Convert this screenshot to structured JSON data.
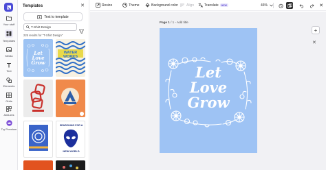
{
  "rail": {
    "items": [
      {
        "label": "Your stuff",
        "icon": "folder-icon"
      },
      {
        "label": "Templates",
        "icon": "templates-icon"
      },
      {
        "label": "Media",
        "icon": "media-icon"
      },
      {
        "label": "Text",
        "icon": "text-icon"
      },
      {
        "label": "Elements",
        "icon": "elements-icon"
      },
      {
        "label": "Grids",
        "icon": "grids-icon"
      },
      {
        "label": "Add-ons",
        "icon": "add-ons-icon"
      },
      {
        "label": "Try Premium",
        "icon": "premium-icon"
      }
    ]
  },
  "panel": {
    "title": "Templates",
    "text_to_template": "Text to template",
    "search_value": "T-Shirt Design",
    "results": "225 results for \"T-Shirt Design\"",
    "thumbs": [
      {
        "caption": "Let Love Grow",
        "color": "#9dc3f3"
      },
      {
        "caption": "WATER WORKS",
        "color": "#f6f1e2"
      },
      {
        "caption": "",
        "color": "#ececec"
      },
      {
        "caption": "",
        "color": "#f08a4b"
      },
      {
        "caption": "",
        "color": "#ffffff"
      },
      {
        "caption_top": "SEARCHING FOR A",
        "caption_bottom": "NEW WORLD",
        "color": "#ffffff"
      }
    ]
  },
  "toolbar": {
    "resize": "Resize",
    "theme": "Theme",
    "background_color": "Background color",
    "align": "Align",
    "translate": "Translate",
    "new_badge": "NEW",
    "zoom": "46%"
  },
  "canvas": {
    "page_label_bold": "Page 1",
    "page_label_rest": " / 1 - Add title",
    "design_text": [
      "Let",
      "Love",
      "Grow"
    ],
    "design_color": "#9ec3f4"
  }
}
